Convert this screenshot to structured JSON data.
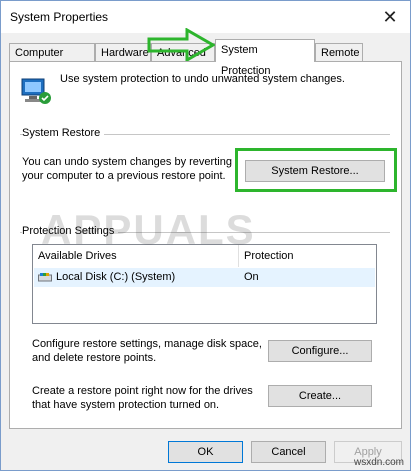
{
  "window": {
    "title": "System Properties",
    "close_glyph": "✕"
  },
  "tabs": [
    {
      "label": "Computer Name"
    },
    {
      "label": "Hardware"
    },
    {
      "label": "Advanced"
    },
    {
      "label": "System Protection"
    },
    {
      "label": "Remote"
    }
  ],
  "intro": {
    "text": "Use system protection to undo unwanted system changes.",
    "icon": "system-computer-icon"
  },
  "system_restore": {
    "group_label": "System Restore",
    "description": "You can undo system changes by reverting your computer to a previous restore point.",
    "button_label": "System Restore...",
    "highlight_color": "#2db52d"
  },
  "protection": {
    "group_label": "Protection Settings",
    "columns": [
      "Available Drives",
      "Protection"
    ],
    "rows": [
      {
        "drive": "Local Disk (C:) (System)",
        "protection": "On",
        "icon": "drive-icon"
      }
    ]
  },
  "configure": {
    "text": "Configure restore settings, manage disk space, and delete restore points.",
    "button_label": "Configure..."
  },
  "create": {
    "text": "Create a restore point right now for the drives that have system protection turned on.",
    "button_label": "Create..."
  },
  "footer": {
    "ok": "OK",
    "cancel": "Cancel",
    "apply": "Apply"
  },
  "watermark": {
    "text": "APPUALS",
    "site": "wsxdn.com"
  },
  "annotation": {
    "arrow_color": "#2db52d",
    "icon": "arrow-right-icon"
  }
}
